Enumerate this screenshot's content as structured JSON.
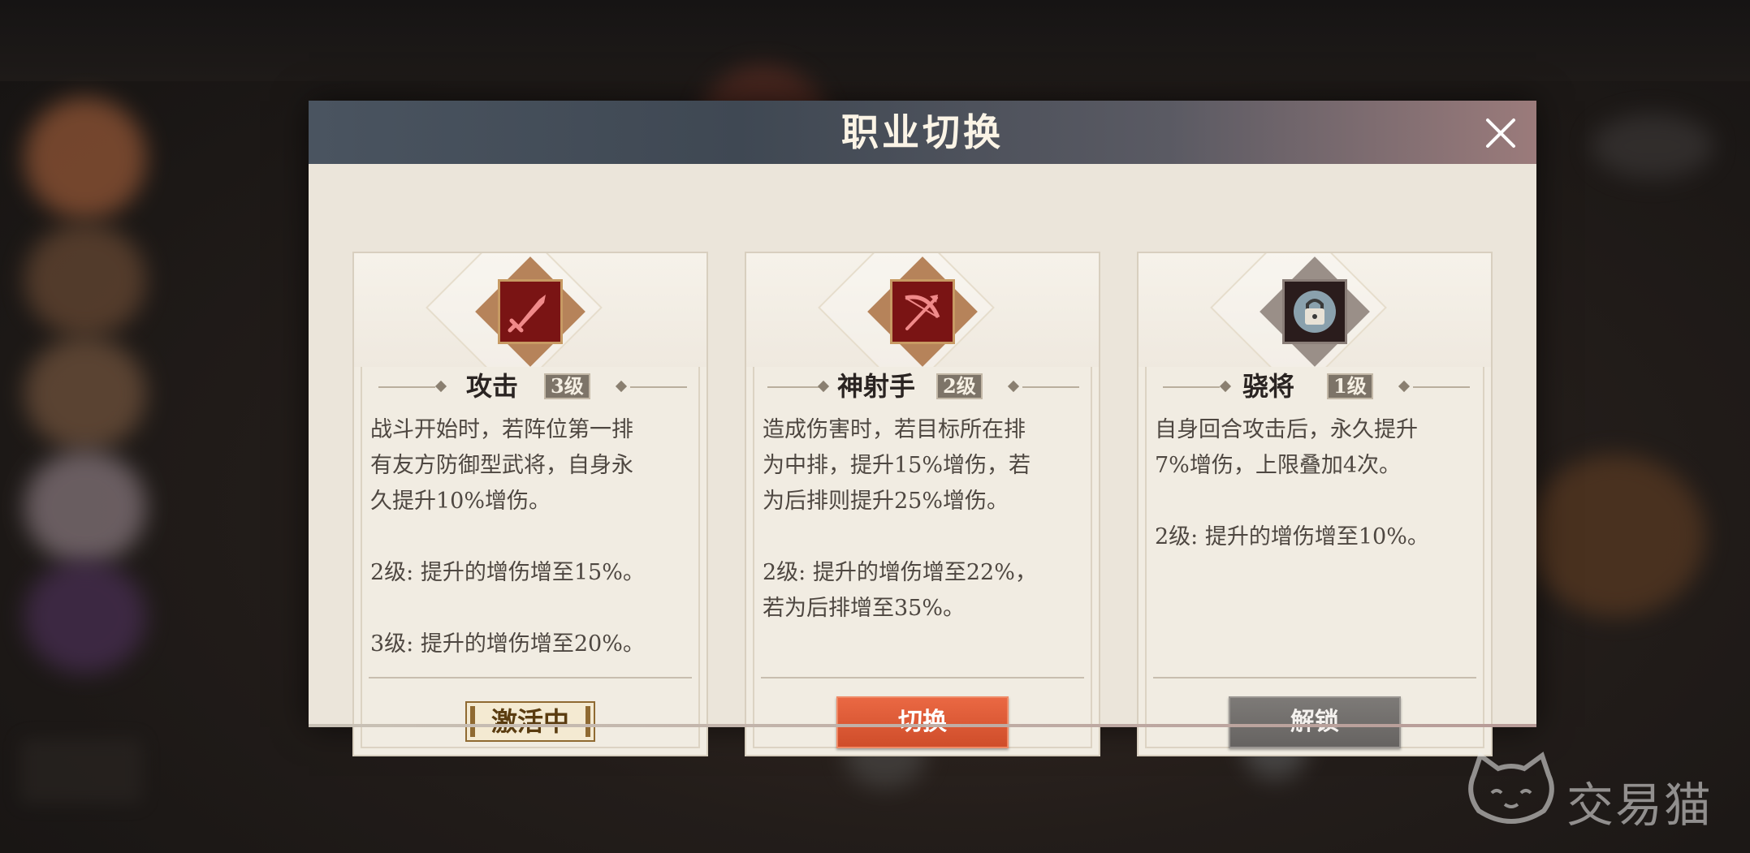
{
  "dialog": {
    "title": "职业切换",
    "close_icon": "close-icon"
  },
  "cards": [
    {
      "name": "攻击",
      "level": "3级",
      "icon": "sword-icon",
      "description": "战斗开始时，若阵位第一排\n有友方防御型武将，自身永\n久提升10%增伤。\n\n2级: 提升的增伤增至15%。\n\n3级: 提升的增伤增至20%。",
      "status": "激活中"
    },
    {
      "name": "神射手",
      "level": "2级",
      "icon": "bow-icon",
      "description": "造成伤害时，若目标所在排\n为中排，提升15%增伤，若\n为后排则提升25%增伤。\n\n2级: 提升的增伤增至22%，\n若为后排增至35%。",
      "button": "切换"
    },
    {
      "name": "骁将",
      "level": "1级",
      "icon": "lock-icon",
      "description": "自身回合攻击后，永久提升\n7%增伤，上限叠加4次。\n\n2级: 提升的增伤增至10%。",
      "button": "解锁"
    }
  ],
  "watermark": {
    "text": "交易猫",
    "icon": "cat-face-icon"
  },
  "colors": {
    "header": "#3f4853",
    "accent_red": "#7a1414",
    "switch_button": "#dc5a35",
    "unlock_button": "#727070"
  }
}
